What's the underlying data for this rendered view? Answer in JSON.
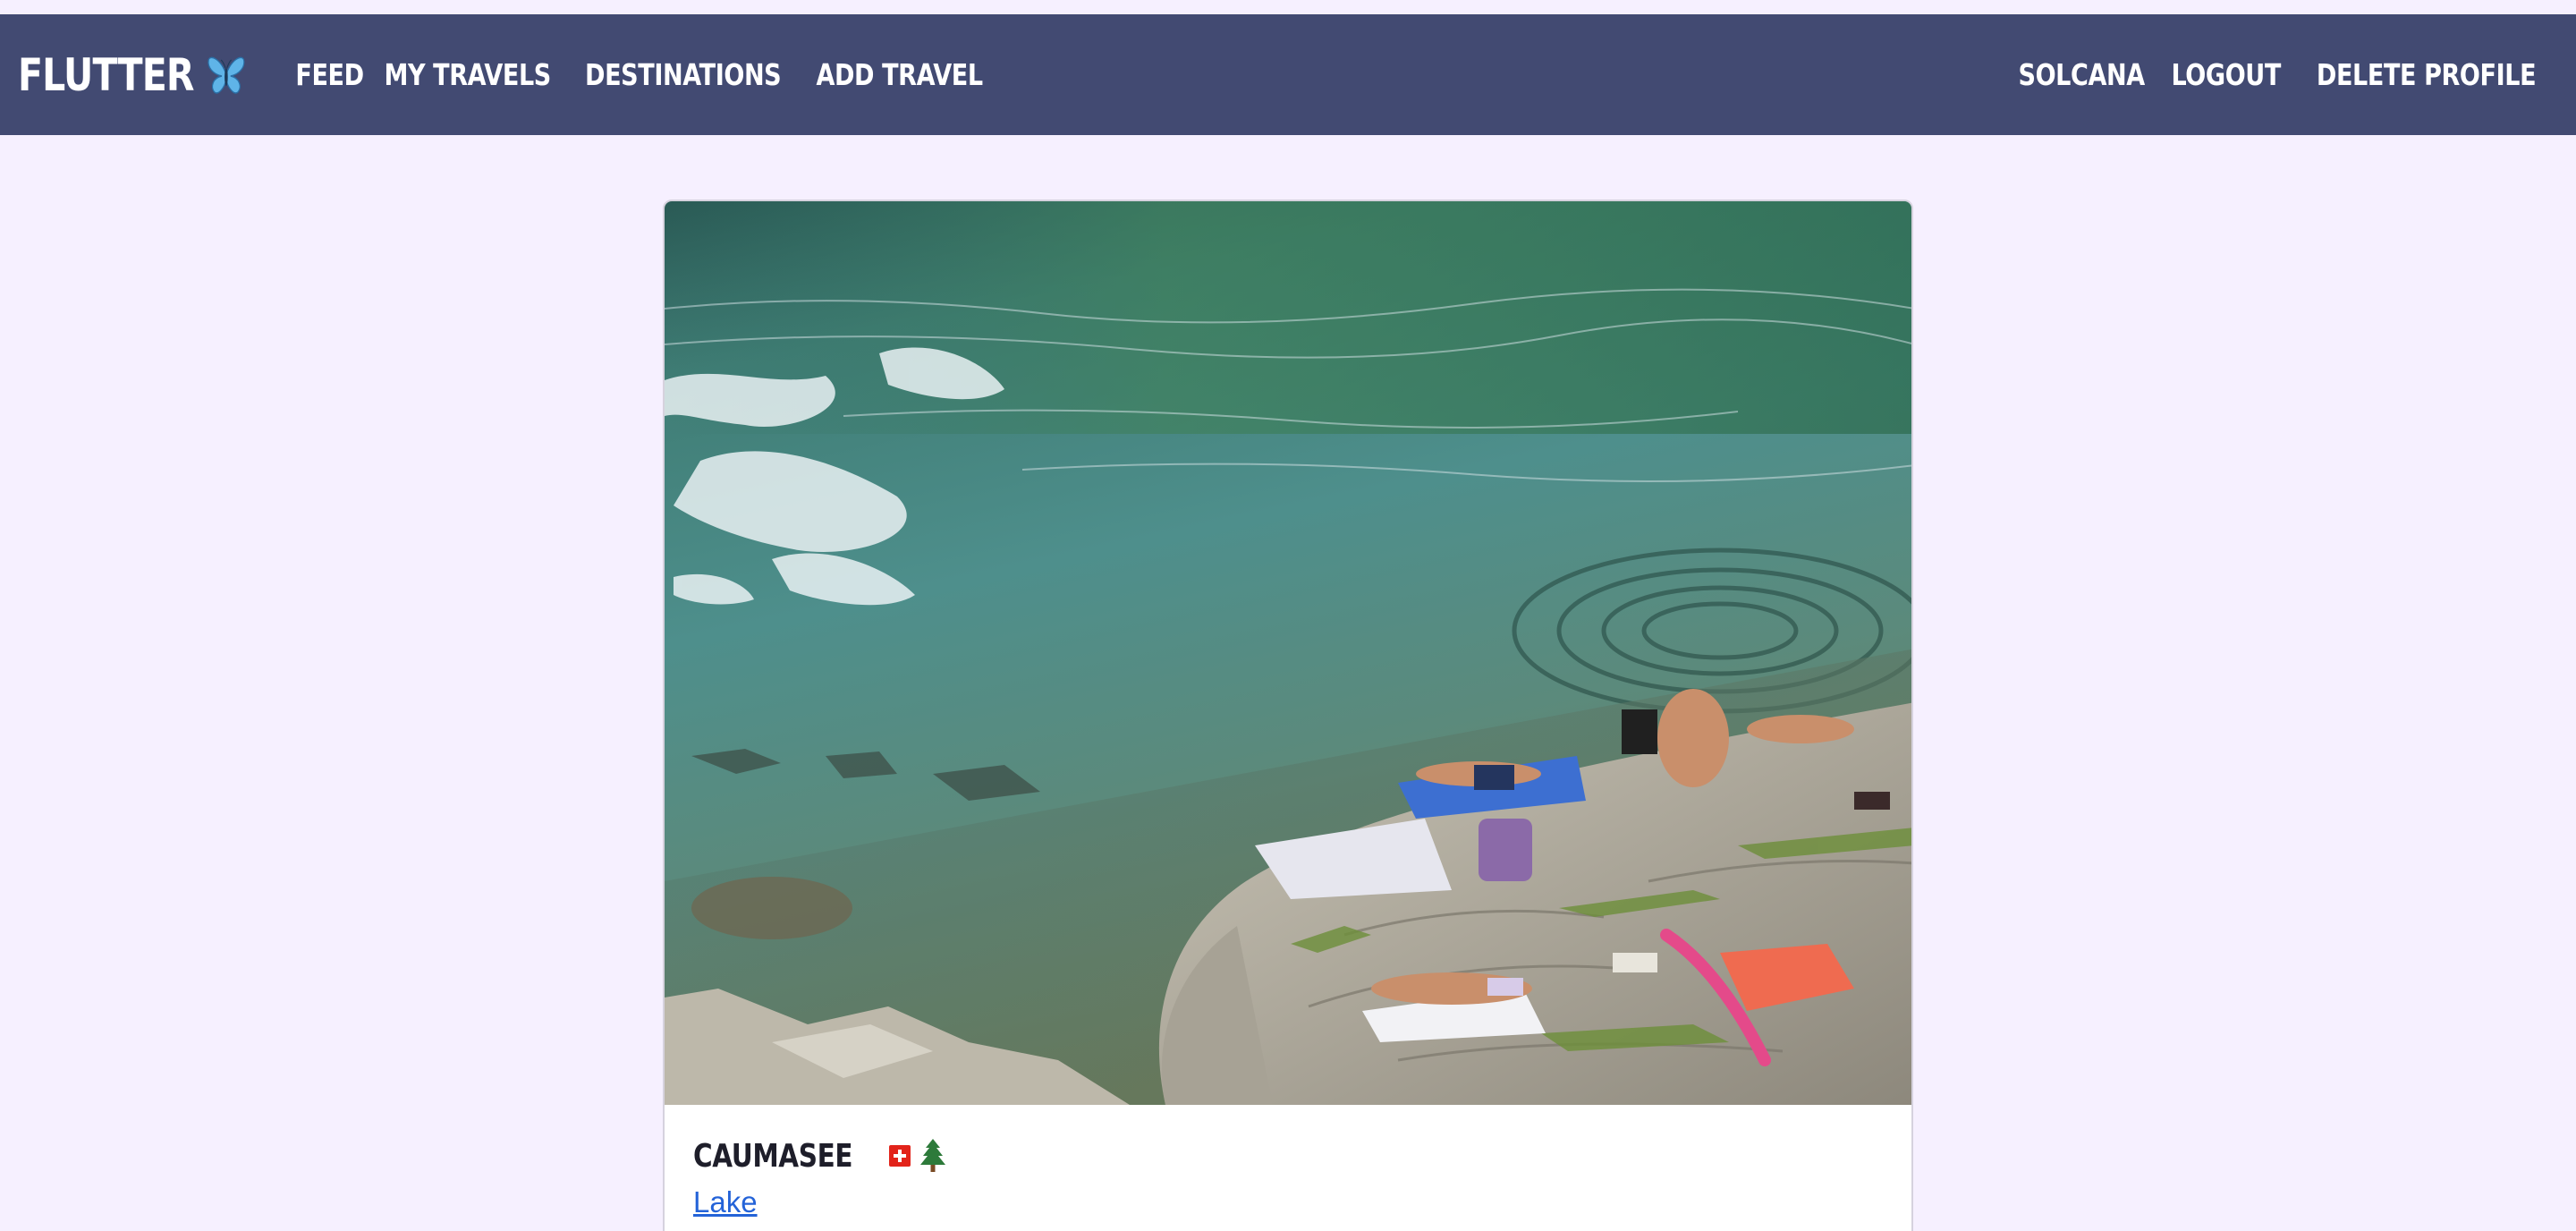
{
  "navbar": {
    "brand": "FLUTTER",
    "brand_icon": "butterfly-icon",
    "left_links": [
      "FEED",
      "MY TRAVELS",
      "DESTINATIONS",
      "ADD TRAVEL"
    ],
    "right_links": [
      "SOLCANA",
      "LOGOUT",
      "DELETE PROFILE"
    ],
    "background_color": "#424a72"
  },
  "card": {
    "image_alt": "Caumasee",
    "title": "CAUMASEE",
    "title_icons": [
      "swiss-flag-icon",
      "evergreen-tree-icon"
    ],
    "category": "Lake"
  },
  "colors": {
    "page_background": "#f6f0ff",
    "link": "#2463d8"
  }
}
